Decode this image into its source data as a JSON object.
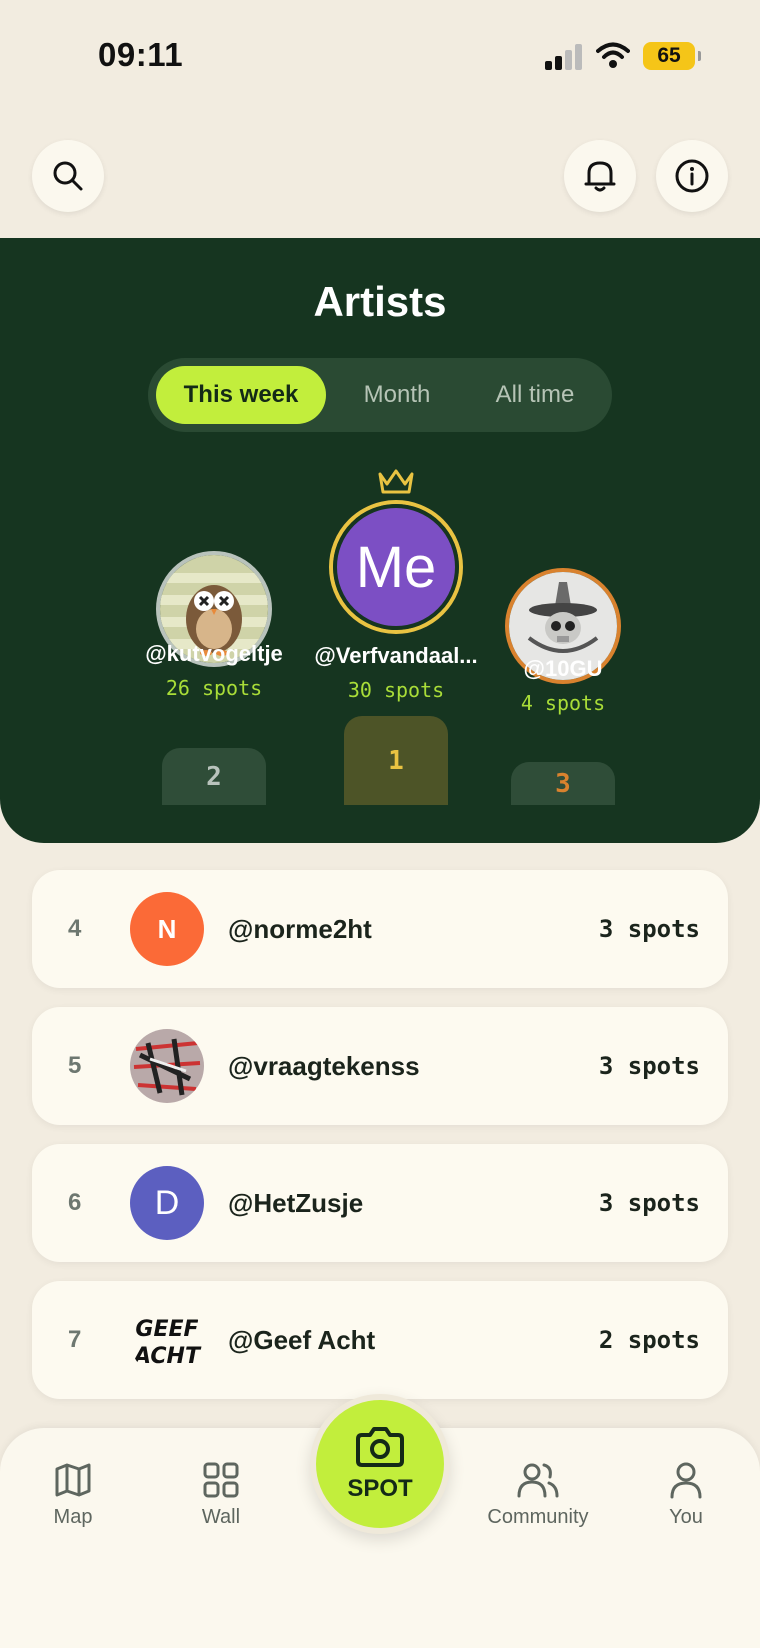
{
  "status": {
    "time": "09:11",
    "battery": "65"
  },
  "hero": {
    "title": "Artists",
    "tabs": [
      {
        "label": "This week",
        "active": true
      },
      {
        "label": "Month",
        "active": false
      },
      {
        "label": "All time",
        "active": false
      }
    ],
    "podium": {
      "first": {
        "name": "@Verfvandaal...",
        "spots": "30 spots",
        "rank": "1",
        "initials": "Me"
      },
      "second": {
        "name": "@kutvogeltje",
        "spots": "26 spots",
        "rank": "2"
      },
      "third": {
        "name": "@10GU",
        "spots": "4 spots",
        "rank": "3"
      }
    }
  },
  "list": [
    {
      "rank": "4",
      "name": "@norme2ht",
      "spots": "3 spots",
      "initial": "N"
    },
    {
      "rank": "5",
      "name": "@vraagtekenss",
      "spots": "3 spots"
    },
    {
      "rank": "6",
      "name": "@HetZusje",
      "spots": "3 spots",
      "initial": "D"
    },
    {
      "rank": "7",
      "name": "@Geef Acht",
      "spots": "2 spots",
      "logo_text": "GEEF ACHT"
    }
  ],
  "nav": {
    "map": "Map",
    "wall": "Wall",
    "spot": "SPOT",
    "community": "Community",
    "you": "You"
  },
  "colors": {
    "hero_bg": "#163520",
    "accent": "#c2ee3c",
    "gold": "#e9c342",
    "silver": "#b9c3bc",
    "bronze": "#d9822e"
  }
}
